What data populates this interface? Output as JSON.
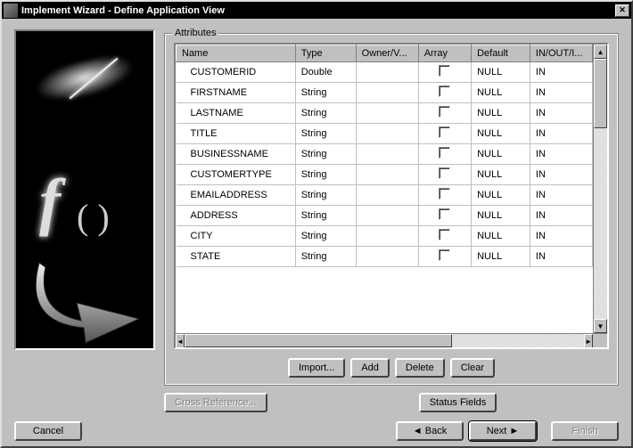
{
  "window": {
    "title": "Implement Wizard - Define Application View"
  },
  "groupbox": {
    "legend": "Attributes"
  },
  "columns": [
    "Name",
    "Type",
    "Owner/V...",
    "Array",
    "Default",
    "IN/OUT/I..."
  ],
  "rows": [
    {
      "name": "CUSTOMERID",
      "type": "Double",
      "owner": "",
      "array": false,
      "default": "NULL",
      "io": "IN"
    },
    {
      "name": "FIRSTNAME",
      "type": "String",
      "owner": "",
      "array": false,
      "default": "NULL",
      "io": "IN"
    },
    {
      "name": "LASTNAME",
      "type": "String",
      "owner": "",
      "array": false,
      "default": "NULL",
      "io": "IN"
    },
    {
      "name": "TITLE",
      "type": "String",
      "owner": "",
      "array": false,
      "default": "NULL",
      "io": "IN"
    },
    {
      "name": "BUSINESSNAME",
      "type": "String",
      "owner": "",
      "array": false,
      "default": "NULL",
      "io": "IN"
    },
    {
      "name": "CUSTOMERTYPE",
      "type": "String",
      "owner": "",
      "array": false,
      "default": "NULL",
      "io": "IN"
    },
    {
      "name": "EMAILADDRESS",
      "type": "String",
      "owner": "",
      "array": false,
      "default": "NULL",
      "io": "IN"
    },
    {
      "name": "ADDRESS",
      "type": "String",
      "owner": "",
      "array": false,
      "default": "NULL",
      "io": "IN"
    },
    {
      "name": "CITY",
      "type": "String",
      "owner": "",
      "array": false,
      "default": "NULL",
      "io": "IN"
    },
    {
      "name": "STATE",
      "type": "String",
      "owner": "",
      "array": false,
      "default": "NULL",
      "io": "IN"
    }
  ],
  "buttons": {
    "import": "Import...",
    "add": "Add",
    "delete": "Delete",
    "clear": "Clear",
    "crossref": "Cross Reference...",
    "statusfields": "Status Fields",
    "cancel": "Cancel",
    "back": "Back",
    "next": "Next",
    "finish": "Finish"
  }
}
